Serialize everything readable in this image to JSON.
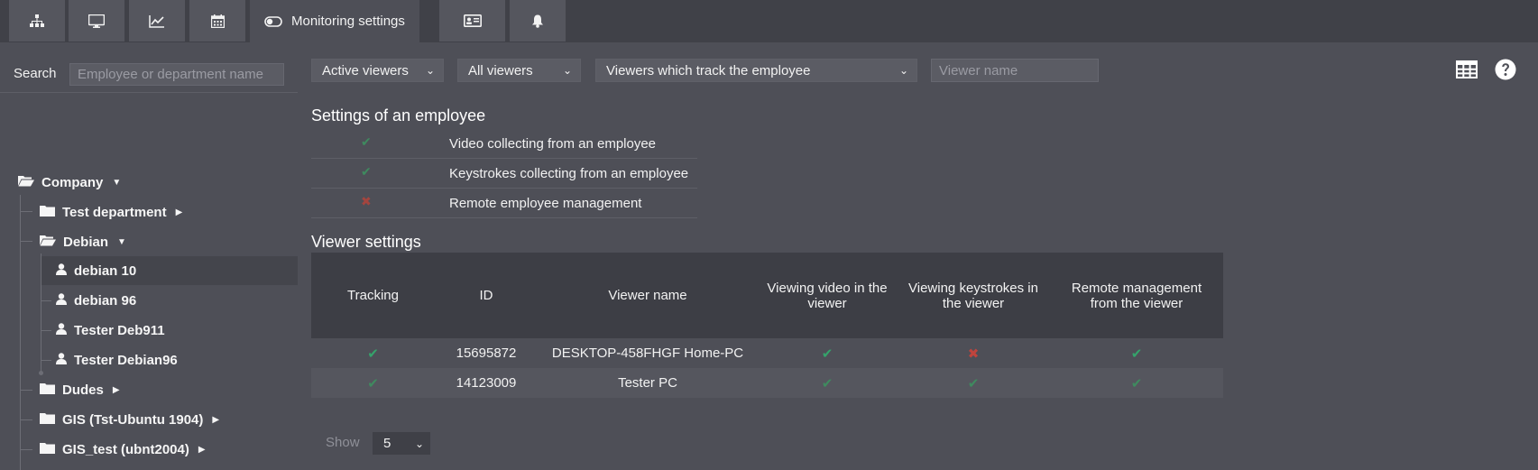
{
  "tabs": [
    {
      "icon": "sitemap-icon"
    },
    {
      "icon": "monitor-icon"
    },
    {
      "icon": "chart-line-icon"
    },
    {
      "icon": "calendar-icon"
    },
    {
      "icon": "toggle-icon",
      "label": "Monitoring settings",
      "active": true
    },
    {
      "icon": "id-card-icon"
    },
    {
      "icon": "bell-icon"
    }
  ],
  "search": {
    "label": "Search",
    "placeholder": "Employee or department name"
  },
  "tree": {
    "root": "Company",
    "items": [
      {
        "label": "Test department",
        "type": "folder"
      },
      {
        "label": "Debian",
        "type": "folder-open"
      },
      {
        "label": "debian 10",
        "type": "user",
        "selected": true
      },
      {
        "label": "debian 96",
        "type": "user"
      },
      {
        "label": "Tester Deb911",
        "type": "user"
      },
      {
        "label": "Tester Debian96",
        "type": "user"
      },
      {
        "label": "Dudes",
        "type": "folder"
      },
      {
        "label": "GIS (Tst-Ubuntu 1904)",
        "type": "folder"
      },
      {
        "label": "GIS_test (ubnt2004)",
        "type": "folder"
      }
    ]
  },
  "filters": {
    "status": "Active viewers",
    "scope": "All viewers",
    "tracking": "Viewers which track the employee",
    "viewer_name_placeholder": "Viewer name"
  },
  "employee_settings": {
    "title": "Settings of an employee",
    "rows": [
      {
        "enabled": true,
        "label": "Video collecting from an employee"
      },
      {
        "enabled": true,
        "label": "Keystrokes collecting from an employee"
      },
      {
        "enabled": false,
        "label": "Remote employee management"
      }
    ]
  },
  "viewer_settings": {
    "title": "Viewer settings",
    "columns": [
      "Tracking",
      "ID",
      "Viewer name",
      "Viewing video in the viewer",
      "Viewing keystrokes in the viewer",
      "Remote management from the viewer"
    ],
    "rows": [
      {
        "tracking": true,
        "id": "15695872",
        "name": "DESKTOP-458FHGF Home-PC",
        "video": true,
        "keystrokes": false,
        "remote": true
      },
      {
        "tracking": true,
        "id": "14123009",
        "name": "Tester PC",
        "video": true,
        "keystrokes": true,
        "remote": true
      }
    ]
  },
  "pagination": {
    "show_label": "Show",
    "page_size": "5"
  },
  "colors": {
    "accent_ok": "#35a36b",
    "accent_bad": "#c0443d",
    "background": "#4e4f57"
  }
}
